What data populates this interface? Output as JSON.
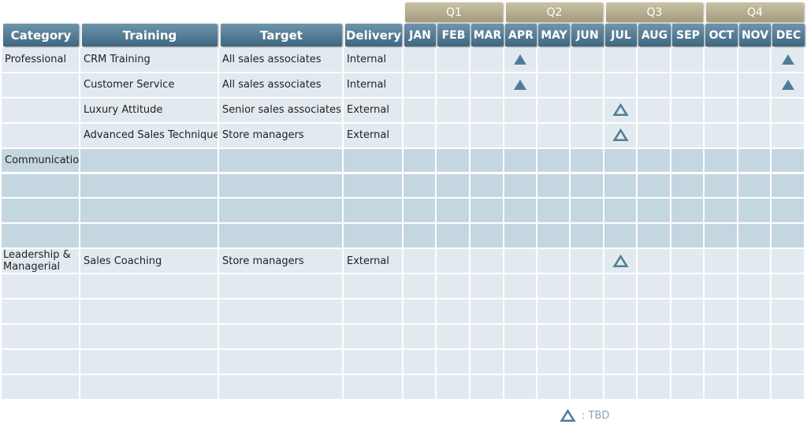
{
  "quarters": [
    "Q1",
    "Q2",
    "Q3",
    "Q4"
  ],
  "headers": {
    "category": "Category",
    "training": "Training",
    "target": "Target",
    "delivery": "Delivery"
  },
  "months": [
    "JAN",
    "FEB",
    "MAR",
    "APR",
    "MAY",
    "JUN",
    "JUL",
    "AUG",
    "SEP",
    "OCT",
    "NOV",
    "DEC"
  ],
  "rows": [
    {
      "category": "Professional",
      "training": "CRM Training",
      "target": "All sales associates",
      "delivery": "Internal",
      "marks": [
        {
          "month": "APR",
          "type": "filled"
        },
        {
          "month": "DEC",
          "type": "filled"
        }
      ]
    },
    {
      "category": "",
      "training": "Customer Service",
      "target": "All sales associates",
      "delivery": "Internal",
      "marks": [
        {
          "month": "APR",
          "type": "filled"
        },
        {
          "month": "DEC",
          "type": "filled"
        }
      ]
    },
    {
      "category": "",
      "training": "Luxury Attitude",
      "target": "Senior sales associates",
      "delivery": "External",
      "marks": [
        {
          "month": "JUL",
          "type": "outline"
        }
      ]
    },
    {
      "category": "",
      "training": "Advanced Sales Technique",
      "target": "Store managers",
      "delivery": "External",
      "marks": [
        {
          "month": "JUL",
          "type": "outline"
        }
      ]
    },
    {
      "category": "Communication",
      "training": "",
      "target": "",
      "delivery": "",
      "marks": []
    },
    {
      "category": "",
      "training": "",
      "target": "",
      "delivery": "",
      "marks": []
    },
    {
      "category": "",
      "training": "",
      "target": "",
      "delivery": "",
      "marks": []
    },
    {
      "category": "",
      "training": "",
      "target": "",
      "delivery": "",
      "marks": []
    },
    {
      "category": "Leadership & Managerial",
      "training": "Sales Coaching",
      "target": "Store managers",
      "delivery": "External",
      "marks": [
        {
          "month": "JUL",
          "type": "outline"
        }
      ]
    },
    {
      "category": "",
      "training": "",
      "target": "",
      "delivery": "",
      "marks": []
    },
    {
      "category": "",
      "training": "",
      "target": "",
      "delivery": "",
      "marks": []
    },
    {
      "category": "",
      "training": "",
      "target": "",
      "delivery": "",
      "marks": []
    },
    {
      "category": "",
      "training": "",
      "target": "",
      "delivery": "",
      "marks": []
    },
    {
      "category": "",
      "training": "",
      "target": "",
      "delivery": "",
      "marks": []
    }
  ],
  "row_shading": [
    "light",
    "light",
    "light",
    "light",
    "dark",
    "dark",
    "dark",
    "dark",
    "light",
    "light",
    "light",
    "light",
    "light",
    "light"
  ],
  "legend": {
    "symbol": "outline-triangle",
    "text": ": TBD"
  },
  "colors": {
    "header": "#4f7891",
    "quarter": "#b3ab8c",
    "light_row": "#e2eaf0",
    "dark_row": "#c4d6e0",
    "marker": "#4f7d98"
  }
}
